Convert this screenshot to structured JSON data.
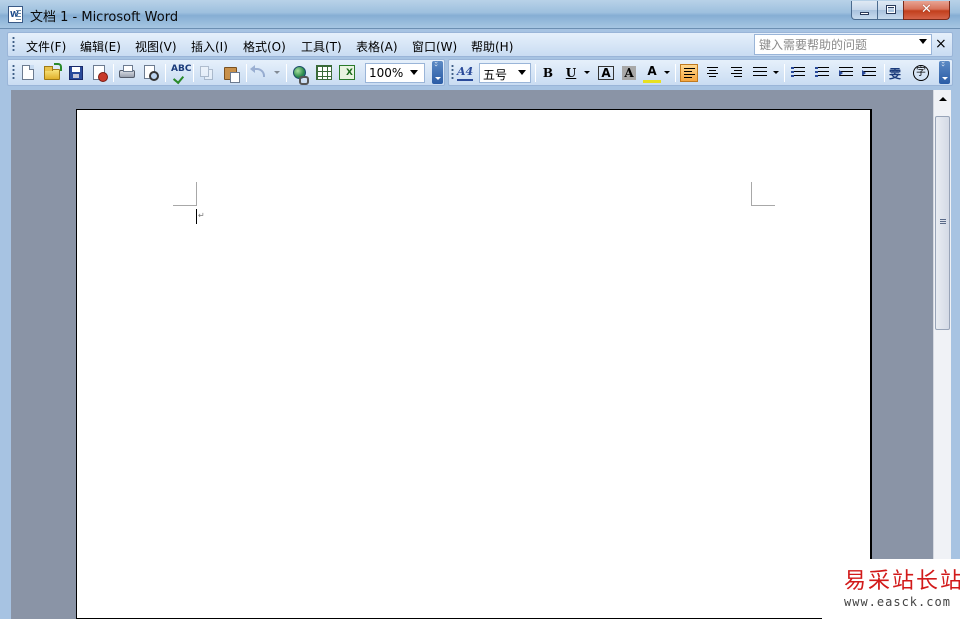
{
  "window": {
    "title": "文档 1 - Microsoft Word",
    "app_icon_label": "W",
    "close_glyph": "✕"
  },
  "menu": {
    "items": [
      {
        "label": "文件(F)"
      },
      {
        "label": "编辑(E)"
      },
      {
        "label": "视图(V)"
      },
      {
        "label": "插入(I)"
      },
      {
        "label": "格式(O)"
      },
      {
        "label": "工具(T)"
      },
      {
        "label": "表格(A)"
      },
      {
        "label": "窗口(W)"
      },
      {
        "label": "帮助(H)"
      }
    ],
    "help_search_placeholder": "键入需要帮助的问题",
    "close_document_glyph": "×"
  },
  "standard_toolbar": {
    "zoom_value": "100%",
    "icons": [
      "new-icon",
      "open-icon",
      "save-icon",
      "permission-icon",
      "print-icon",
      "print-preview-icon",
      "spelling-icon",
      "copy-icon",
      "paste-icon",
      "undo-icon",
      "hyperlink-icon",
      "tables-borders-icon",
      "insert-excel-icon"
    ]
  },
  "format_toolbar": {
    "styles_glyph": "A4",
    "font_size": "五号",
    "bold": "B",
    "underline": "U",
    "char_border": "A",
    "char_shading": "A",
    "highlight": "A",
    "phonetic": "雯",
    "enclosed_char": "字",
    "active_alignment": "left"
  },
  "document": {
    "paragraph_mark": "↵"
  },
  "watermark": {
    "title": "易采站长站",
    "url": "www.easck.com"
  },
  "colors": {
    "title_bar": "#9ec0de",
    "toolbar": "#c9dcf2",
    "workspace": "#8a94a6",
    "close_button": "#c23f1c",
    "active_button": "#f6a640",
    "watermark_red": "#d21a1a"
  }
}
